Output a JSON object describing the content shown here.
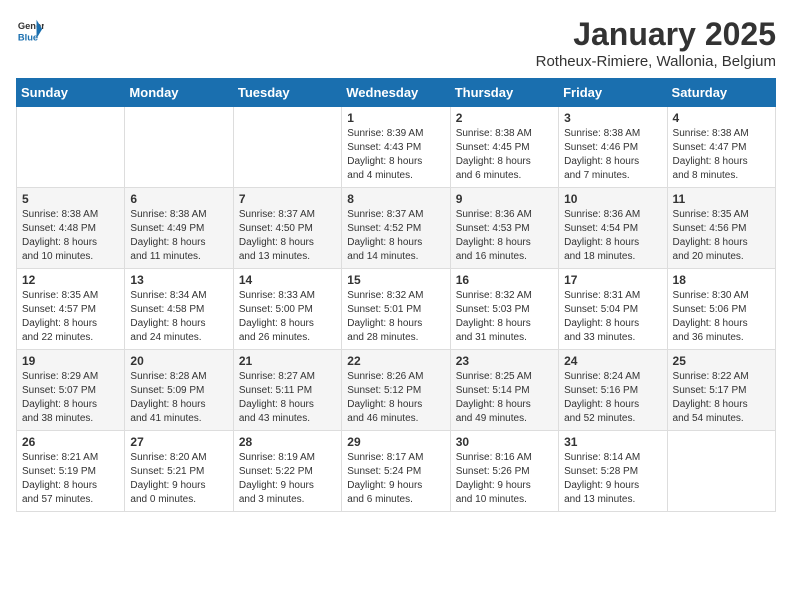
{
  "header": {
    "logo_general": "General",
    "logo_blue": "Blue",
    "title": "January 2025",
    "subtitle": "Rotheux-Rimiere, Wallonia, Belgium"
  },
  "weekdays": [
    "Sunday",
    "Monday",
    "Tuesday",
    "Wednesday",
    "Thursday",
    "Friday",
    "Saturday"
  ],
  "weeks": [
    [
      {
        "day": "",
        "info": ""
      },
      {
        "day": "",
        "info": ""
      },
      {
        "day": "",
        "info": ""
      },
      {
        "day": "1",
        "info": "Sunrise: 8:39 AM\nSunset: 4:43 PM\nDaylight: 8 hours\nand 4 minutes."
      },
      {
        "day": "2",
        "info": "Sunrise: 8:38 AM\nSunset: 4:45 PM\nDaylight: 8 hours\nand 6 minutes."
      },
      {
        "day": "3",
        "info": "Sunrise: 8:38 AM\nSunset: 4:46 PM\nDaylight: 8 hours\nand 7 minutes."
      },
      {
        "day": "4",
        "info": "Sunrise: 8:38 AM\nSunset: 4:47 PM\nDaylight: 8 hours\nand 8 minutes."
      }
    ],
    [
      {
        "day": "5",
        "info": "Sunrise: 8:38 AM\nSunset: 4:48 PM\nDaylight: 8 hours\nand 10 minutes."
      },
      {
        "day": "6",
        "info": "Sunrise: 8:38 AM\nSunset: 4:49 PM\nDaylight: 8 hours\nand 11 minutes."
      },
      {
        "day": "7",
        "info": "Sunrise: 8:37 AM\nSunset: 4:50 PM\nDaylight: 8 hours\nand 13 minutes."
      },
      {
        "day": "8",
        "info": "Sunrise: 8:37 AM\nSunset: 4:52 PM\nDaylight: 8 hours\nand 14 minutes."
      },
      {
        "day": "9",
        "info": "Sunrise: 8:36 AM\nSunset: 4:53 PM\nDaylight: 8 hours\nand 16 minutes."
      },
      {
        "day": "10",
        "info": "Sunrise: 8:36 AM\nSunset: 4:54 PM\nDaylight: 8 hours\nand 18 minutes."
      },
      {
        "day": "11",
        "info": "Sunrise: 8:35 AM\nSunset: 4:56 PM\nDaylight: 8 hours\nand 20 minutes."
      }
    ],
    [
      {
        "day": "12",
        "info": "Sunrise: 8:35 AM\nSunset: 4:57 PM\nDaylight: 8 hours\nand 22 minutes."
      },
      {
        "day": "13",
        "info": "Sunrise: 8:34 AM\nSunset: 4:58 PM\nDaylight: 8 hours\nand 24 minutes."
      },
      {
        "day": "14",
        "info": "Sunrise: 8:33 AM\nSunset: 5:00 PM\nDaylight: 8 hours\nand 26 minutes."
      },
      {
        "day": "15",
        "info": "Sunrise: 8:32 AM\nSunset: 5:01 PM\nDaylight: 8 hours\nand 28 minutes."
      },
      {
        "day": "16",
        "info": "Sunrise: 8:32 AM\nSunset: 5:03 PM\nDaylight: 8 hours\nand 31 minutes."
      },
      {
        "day": "17",
        "info": "Sunrise: 8:31 AM\nSunset: 5:04 PM\nDaylight: 8 hours\nand 33 minutes."
      },
      {
        "day": "18",
        "info": "Sunrise: 8:30 AM\nSunset: 5:06 PM\nDaylight: 8 hours\nand 36 minutes."
      }
    ],
    [
      {
        "day": "19",
        "info": "Sunrise: 8:29 AM\nSunset: 5:07 PM\nDaylight: 8 hours\nand 38 minutes."
      },
      {
        "day": "20",
        "info": "Sunrise: 8:28 AM\nSunset: 5:09 PM\nDaylight: 8 hours\nand 41 minutes."
      },
      {
        "day": "21",
        "info": "Sunrise: 8:27 AM\nSunset: 5:11 PM\nDaylight: 8 hours\nand 43 minutes."
      },
      {
        "day": "22",
        "info": "Sunrise: 8:26 AM\nSunset: 5:12 PM\nDaylight: 8 hours\nand 46 minutes."
      },
      {
        "day": "23",
        "info": "Sunrise: 8:25 AM\nSunset: 5:14 PM\nDaylight: 8 hours\nand 49 minutes."
      },
      {
        "day": "24",
        "info": "Sunrise: 8:24 AM\nSunset: 5:16 PM\nDaylight: 8 hours\nand 52 minutes."
      },
      {
        "day": "25",
        "info": "Sunrise: 8:22 AM\nSunset: 5:17 PM\nDaylight: 8 hours\nand 54 minutes."
      }
    ],
    [
      {
        "day": "26",
        "info": "Sunrise: 8:21 AM\nSunset: 5:19 PM\nDaylight: 8 hours\nand 57 minutes."
      },
      {
        "day": "27",
        "info": "Sunrise: 8:20 AM\nSunset: 5:21 PM\nDaylight: 9 hours\nand 0 minutes."
      },
      {
        "day": "28",
        "info": "Sunrise: 8:19 AM\nSunset: 5:22 PM\nDaylight: 9 hours\nand 3 minutes."
      },
      {
        "day": "29",
        "info": "Sunrise: 8:17 AM\nSunset: 5:24 PM\nDaylight: 9 hours\nand 6 minutes."
      },
      {
        "day": "30",
        "info": "Sunrise: 8:16 AM\nSunset: 5:26 PM\nDaylight: 9 hours\nand 10 minutes."
      },
      {
        "day": "31",
        "info": "Sunrise: 8:14 AM\nSunset: 5:28 PM\nDaylight: 9 hours\nand 13 minutes."
      },
      {
        "day": "",
        "info": ""
      }
    ]
  ]
}
